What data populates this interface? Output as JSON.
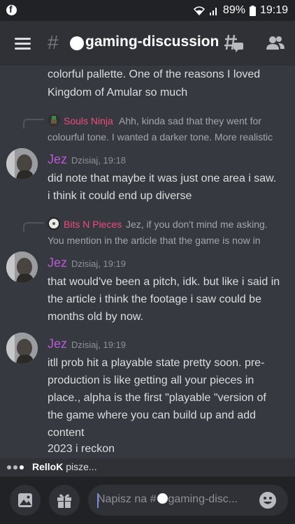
{
  "status_bar": {
    "battery": "89%",
    "time": "19:19"
  },
  "header": {
    "hash": "#",
    "channel_name": "gaming-discussion"
  },
  "messages": {
    "continued_line_1": "colorful pallette.  One of the reasons I loved",
    "continued_line_2": "Kingdom of Amular so much",
    "reply_1": {
      "author": "Souls Ninja",
      "text_1": "Ahh, kinda sad that they went for",
      "text_2": "colourful tone. I wanted a darker tone. More realistic"
    },
    "msg_1": {
      "author": "Jez",
      "timestamp": "Dzisiaj, 19:18",
      "lines": [
        "did note that maybe it was just one area i saw.",
        "i think it could end up diverse"
      ]
    },
    "reply_2": {
      "author": "Bits N Pieces",
      "text_1": "Jez, if you don't mind me asking.",
      "text_2": "You mention in the article that the game is now in"
    },
    "msg_2": {
      "author": "Jez",
      "timestamp": "Dzisiaj, 19:19",
      "lines": [
        "that would've been a pitch, idk. but like i said in",
        "the article i think the footage i saw could be",
        "months old by now."
      ]
    },
    "msg_3": {
      "author": "Jez",
      "timestamp": "Dzisiaj, 19:19",
      "lines": [
        "itll prob hit a playable state pretty soon. pre-",
        "production is like getting all your pieces in",
        "place., alpha is the first \"playable \"version of",
        "the game where you can build up and add",
        "content",
        "2023 i reckon"
      ]
    }
  },
  "typing": {
    "user": "RelloK",
    "text": " pisze..."
  },
  "composer": {
    "placeholder_prefix": "Napisz na #",
    "placeholder_channel": "gaming-disc..."
  },
  "colors": {
    "accent": "#7289da",
    "author": "#b65ad6",
    "reply_author": "#f04b7b"
  }
}
